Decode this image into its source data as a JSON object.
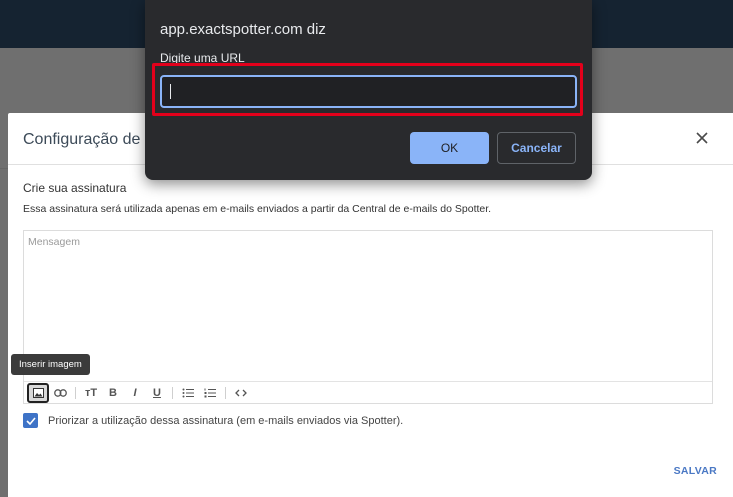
{
  "modal": {
    "title": "Configuração de a",
    "section_title": "Crie sua assinatura",
    "section_description": "Essa assinatura será utilizada apenas em e-mails enviados a partir da Central de e-mails do Spotter.",
    "editor_placeholder": "Mensagem",
    "tooltip": "Inserir imagem",
    "toolbar_icons": [
      "image-icon",
      "link-icon",
      "font-size-icon",
      "bold-icon",
      "italic-icon",
      "underline-icon",
      "bullet-list-icon",
      "numbered-list-icon",
      "code-icon"
    ],
    "toolbar_glyphs": {
      "bold": "B",
      "italic": "I",
      "underline": "U",
      "font_size": "тT"
    },
    "checkbox_label": "Priorizar a utilização dessa assinatura (em e-mails enviados via Spotter).",
    "checkbox_checked": true,
    "save_label": "SALVAR"
  },
  "dialog": {
    "origin": "app.exactspotter.com diz",
    "message": "Digite uma URL",
    "input_value": "",
    "ok_label": "OK",
    "cancel_label": "Cancelar"
  },
  "colors": {
    "accent": "#8ab4f8",
    "highlight": "#e3001b",
    "checkbox": "#3e73c7",
    "save": "#4a78c4"
  }
}
